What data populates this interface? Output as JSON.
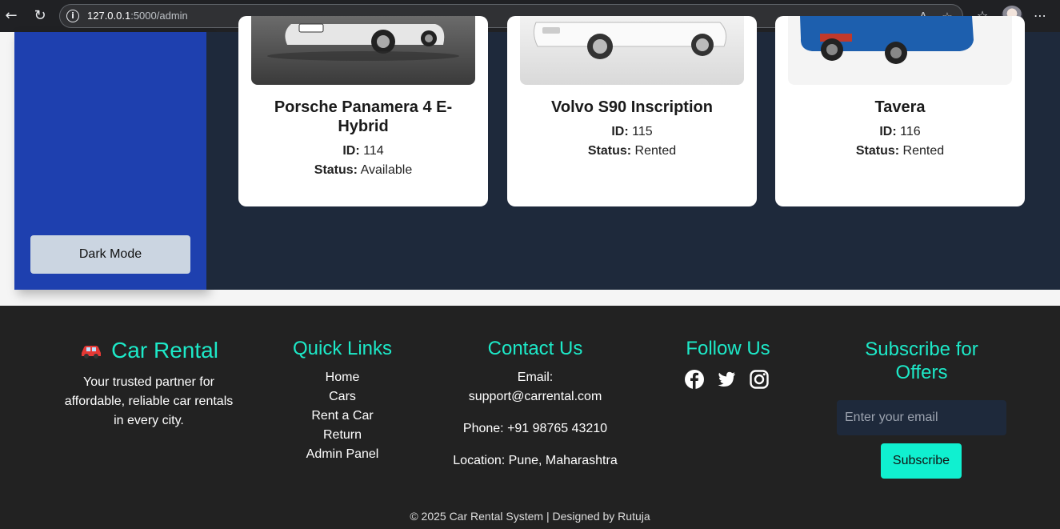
{
  "browser": {
    "url_host": "127.0.0.1",
    "url_rest": ":5000/admin",
    "icons": [
      "back-icon",
      "reload-icon",
      "info-icon",
      "read-aloud-icon",
      "favorite-icon",
      "favorites-bar-icon",
      "profile-avatar",
      "more-icon"
    ]
  },
  "sidebar": {
    "dark_mode_label": "Dark Mode"
  },
  "cars": [
    {
      "name": "Porsche Panamera 4 E-Hybrid",
      "id_label": "ID:",
      "id": "114",
      "status_label": "Status:",
      "status": "Available"
    },
    {
      "name": "Volvo S90 Inscription",
      "id_label": "ID:",
      "id": "115",
      "status_label": "Status:",
      "status": "Rented"
    },
    {
      "name": "Tavera",
      "id_label": "ID:",
      "id": "116",
      "status_label": "Status:",
      "status": "Rented"
    }
  ],
  "footer": {
    "brand": "Car Rental",
    "tagline_1": "Your trusted partner for",
    "tagline_2": "affordable, reliable car rentals",
    "tagline_3": "in every city.",
    "quick_links_title": "Quick Links",
    "links": [
      "Home",
      "Cars",
      "Rent a Car",
      "Return",
      "Admin Panel"
    ],
    "contact_title": "Contact Us",
    "email_label": "Email:",
    "email": "support@carrental.com",
    "phone": "Phone: +91 98765 43210",
    "location": "Location: Pune, Maharashtra",
    "follow_title": "Follow Us",
    "social_icons": [
      "facebook-icon",
      "twitter-icon",
      "instagram-icon"
    ],
    "subscribe_title_1": "Subscribe for",
    "subscribe_title_2": "Offers",
    "email_placeholder": "Enter your email",
    "subscribe_button": "Subscribe",
    "copyright": "© 2025 Car Rental System | Designed by Rutuja"
  },
  "colors": {
    "sidebar": "#1e40af",
    "main_bg": "#1e293b",
    "footer_bg": "#222222",
    "accent": "#1de9c8"
  }
}
